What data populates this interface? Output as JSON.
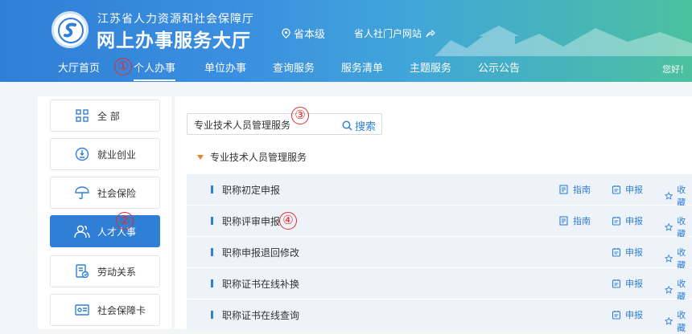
{
  "header": {
    "org_name": "江苏省人力资源和社会保障厅",
    "site_name": "网上办事服务大厅",
    "location": "省本级",
    "portal_link": "省人社门户网站",
    "greeting": "您好！"
  },
  "nav": {
    "items": [
      "大厅首页",
      "个人办事",
      "单位办事",
      "查询服务",
      "服务清单",
      "主题服务",
      "公示公告"
    ],
    "active": "个人办事"
  },
  "markers": [
    "①",
    "②",
    "③",
    "④"
  ],
  "sidebar": {
    "items": [
      {
        "label": "全 部",
        "icon": "grid-icon"
      },
      {
        "label": "就业创业",
        "icon": "employment-icon"
      },
      {
        "label": "社会保险",
        "icon": "umbrella-icon"
      },
      {
        "label": "人才人事",
        "icon": "people-icon"
      },
      {
        "label": "劳动关系",
        "icon": "document-icon"
      },
      {
        "label": "社会保障卡",
        "icon": "card-icon"
      }
    ],
    "active": "人才人事"
  },
  "search": {
    "value": "专业技术人员管理服务",
    "button_label": "搜索"
  },
  "group": {
    "title": "专业技术人员管理服务"
  },
  "actions": {
    "guide": "指南",
    "apply": "申报",
    "favorite": "收藏"
  },
  "services": [
    {
      "name": "职称初定申报",
      "has_guide": true
    },
    {
      "name": "职称评审申报",
      "has_guide": true
    },
    {
      "name": "职称申报退回修改",
      "has_guide": false
    },
    {
      "name": "职称证书在线补换",
      "has_guide": false
    },
    {
      "name": "职称证书在线查询",
      "has_guide": false
    }
  ],
  "colors": {
    "primary": "#2f7fd6",
    "marker": "#e32b2b",
    "triangle": "#e8832a"
  }
}
